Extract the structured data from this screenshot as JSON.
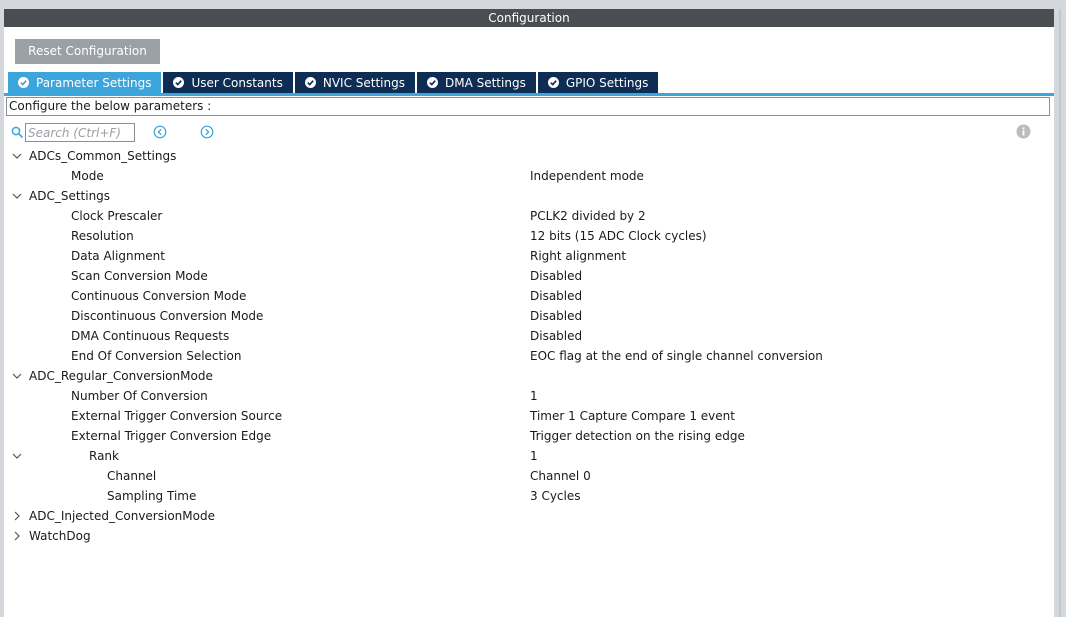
{
  "window": {
    "title": "Configuration"
  },
  "toolbar": {
    "reset_label": "Reset Configuration"
  },
  "tabs": [
    {
      "label": "Parameter Settings",
      "active": true
    },
    {
      "label": "User Constants",
      "active": false
    },
    {
      "label": "NVIC Settings",
      "active": false
    },
    {
      "label": "DMA Settings",
      "active": false
    },
    {
      "label": "GPIO Settings",
      "active": false
    }
  ],
  "description": "Configure the below parameters :",
  "search": {
    "placeholder": "Search (Ctrl+F)",
    "value": ""
  },
  "icons": {
    "search": "search-icon",
    "prev": "chevron-left-circle-icon",
    "next": "chevron-right-circle-icon",
    "info": "info-icon",
    "tab_check": "check-circle-icon"
  },
  "colors": {
    "accent": "#3ba5dc",
    "tab_inactive": "#0d2d55",
    "titlebar": "#4a4d51",
    "button": "#9aa0a6"
  },
  "tree": {
    "groups": [
      {
        "label": "ADCs_Common_Settings",
        "expanded": true,
        "items": [
          {
            "label": "Mode",
            "value": "Independent mode"
          }
        ]
      },
      {
        "label": "ADC_Settings",
        "expanded": true,
        "items": [
          {
            "label": "Clock Prescaler",
            "value": "PCLK2 divided by 2"
          },
          {
            "label": "Resolution",
            "value": "12 bits (15 ADC Clock cycles)"
          },
          {
            "label": "Data Alignment",
            "value": "Right alignment"
          },
          {
            "label": "Scan Conversion Mode",
            "value": "Disabled"
          },
          {
            "label": "Continuous Conversion Mode",
            "value": "Disabled"
          },
          {
            "label": "Discontinuous Conversion Mode",
            "value": "Disabled"
          },
          {
            "label": "DMA Continuous Requests",
            "value": "Disabled"
          },
          {
            "label": "End Of Conversion Selection",
            "value": "EOC flag at the end of single channel conversion"
          }
        ]
      },
      {
        "label": "ADC_Regular_ConversionMode",
        "expanded": true,
        "items": [
          {
            "label": "Number Of Conversion",
            "value": "1"
          },
          {
            "label": "External Trigger Conversion Source",
            "value": "Timer 1 Capture Compare 1 event"
          },
          {
            "label": "External Trigger Conversion Edge",
            "value": "Trigger detection on the rising edge"
          }
        ],
        "rank": {
          "label": "Rank",
          "value": "1",
          "expanded": true,
          "items": [
            {
              "label": "Channel",
              "value": "Channel 0"
            },
            {
              "label": "Sampling Time",
              "value": "3 Cycles"
            }
          ]
        }
      },
      {
        "label": "ADC_Injected_ConversionMode",
        "expanded": false,
        "items": []
      },
      {
        "label": "WatchDog",
        "expanded": false,
        "items": []
      }
    ]
  }
}
